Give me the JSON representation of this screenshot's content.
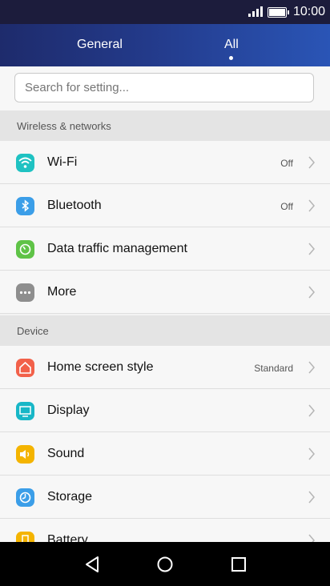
{
  "status_bar": {
    "time": "10:00"
  },
  "tabs": {
    "general": "General",
    "all": "All",
    "active": "All"
  },
  "search": {
    "placeholder": "Search for setting..."
  },
  "sections": {
    "wireless": "Wireless & networks",
    "device": "Device"
  },
  "rows": [
    {
      "label": "Wi-Fi",
      "value": "Off",
      "icon": "wifi-icon",
      "color": "#1fc2c2"
    },
    {
      "label": "Bluetooth",
      "value": "Off",
      "icon": "bluetooth-icon",
      "color": "#3b9ee8"
    },
    {
      "label": "Data traffic management",
      "value": "",
      "icon": "data-traffic-icon",
      "color": "#5fc347"
    },
    {
      "label": "More",
      "value": "",
      "icon": "more-icon",
      "color": "#8e8e8e"
    },
    {
      "label": "Home screen style",
      "value": "Standard",
      "icon": "home-icon",
      "color": "#f2614a"
    },
    {
      "label": "Display",
      "value": "",
      "icon": "display-icon",
      "color": "#18b7c7"
    },
    {
      "label": "Sound",
      "value": "",
      "icon": "sound-icon",
      "color": "#f4b400"
    },
    {
      "label": "Storage",
      "value": "",
      "icon": "storage-icon",
      "color": "#3b9ee8"
    },
    {
      "label": "Battery",
      "value": "",
      "icon": "battery-icon",
      "color": "#f4b400"
    }
  ],
  "colors": {
    "header_start": "#1e2b6c",
    "header_end": "#2a55b6",
    "accent": "#ffffff"
  }
}
